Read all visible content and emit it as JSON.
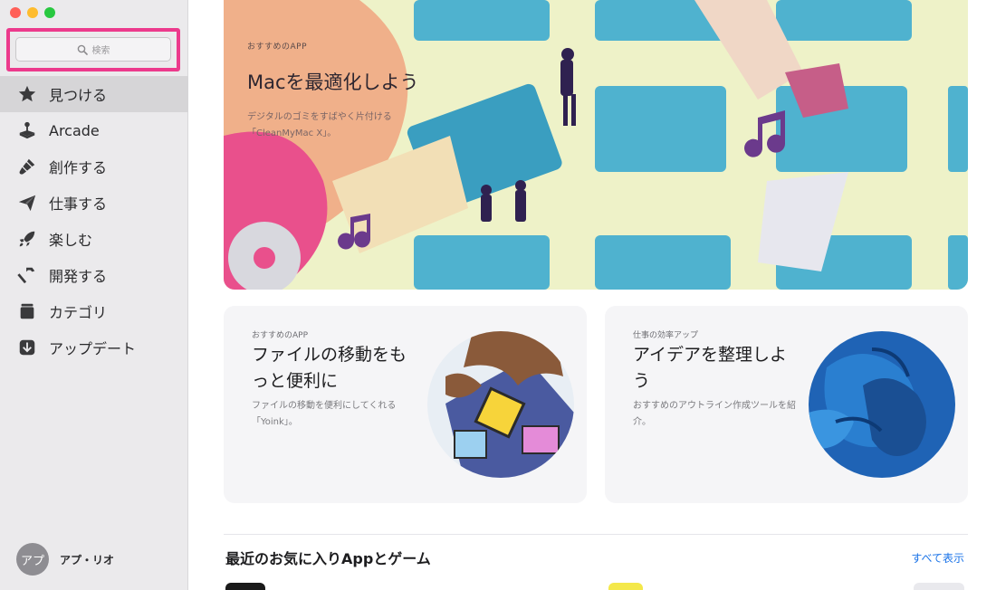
{
  "sidebar": {
    "search_placeholder": "検索",
    "items": [
      {
        "label": "見つける",
        "icon": "star-icon",
        "active": true
      },
      {
        "label": "Arcade",
        "icon": "joystick-icon"
      },
      {
        "label": "創作する",
        "icon": "brush-icon"
      },
      {
        "label": "仕事する",
        "icon": "paper-plane-icon"
      },
      {
        "label": "楽しむ",
        "icon": "rocket-icon"
      },
      {
        "label": "開発する",
        "icon": "hammer-icon"
      },
      {
        "label": "カテゴリ",
        "icon": "stack-icon"
      },
      {
        "label": "アップデート",
        "icon": "download-icon"
      }
    ],
    "account": {
      "avatar_initials": "アプ",
      "name": "アプ・リオ"
    }
  },
  "hero": {
    "eyebrow": "おすすめのAPP",
    "title": "Macを最適化しよう",
    "subtitle": "デジタルのゴミをすばやく片付ける「CleanMyMac X」。"
  },
  "cards": [
    {
      "eyebrow": "おすすめのAPP",
      "title": "ファイルの移動をもっと便利に",
      "description": "ファイルの移動を便利にしてくれる「Yoink」。"
    },
    {
      "eyebrow": "仕事の効率アップ",
      "title": "アイデアを整理しよう",
      "description": "おすすめのアウトライン作成ツールを紹介。"
    }
  ],
  "section": {
    "title": "最近のお気に入りAppとゲーム",
    "see_all": "すべて表示"
  },
  "colors": {
    "highlight": "#ec3a8c",
    "link": "#1a73e8",
    "sidebar_bg": "#ebeaec"
  }
}
